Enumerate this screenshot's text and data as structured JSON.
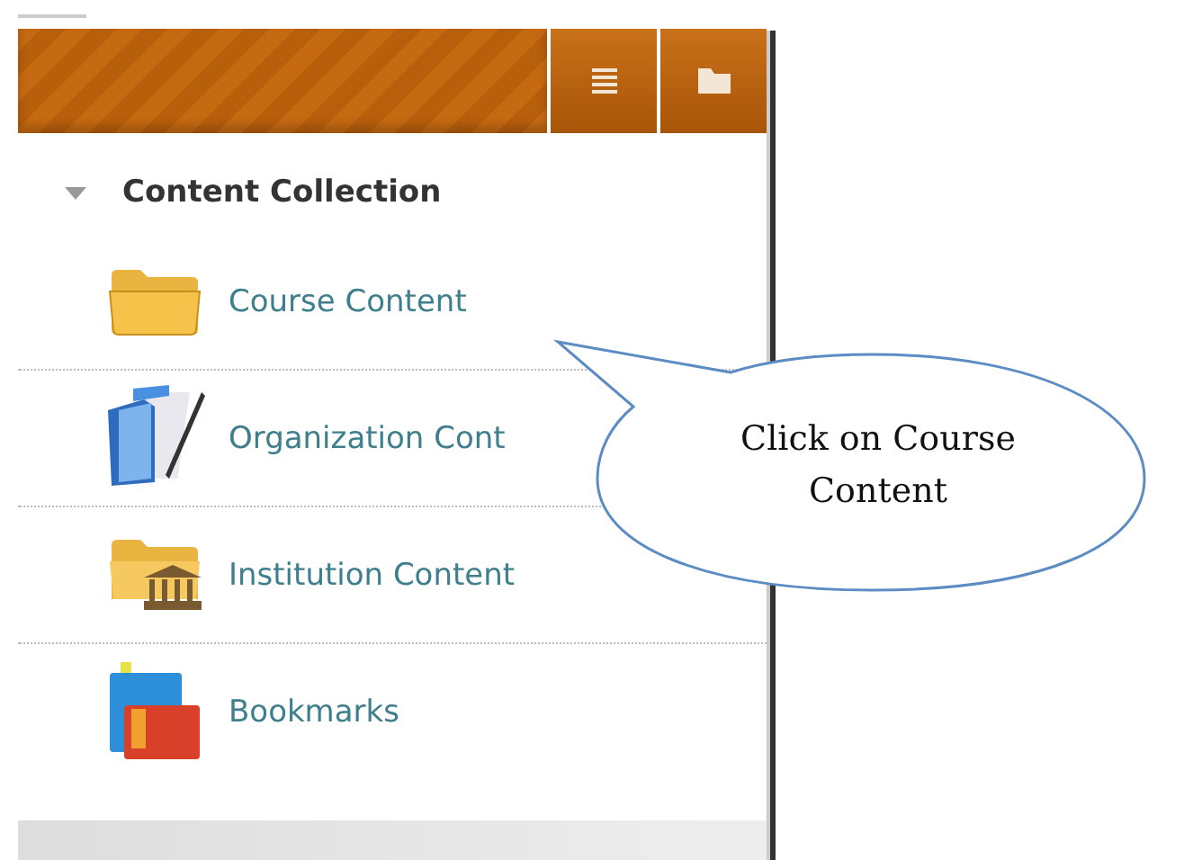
{
  "panel": {
    "heading": "Content Collection",
    "expanded": true,
    "items": [
      {
        "kind": "course",
        "label": "Course Content"
      },
      {
        "kind": "organization",
        "label": "Organization Cont"
      },
      {
        "kind": "institution",
        "label": "Institution Content"
      },
      {
        "kind": "bookmarks",
        "label": "Bookmarks"
      }
    ]
  },
  "callout": {
    "text": "Click on Course Content"
  }
}
